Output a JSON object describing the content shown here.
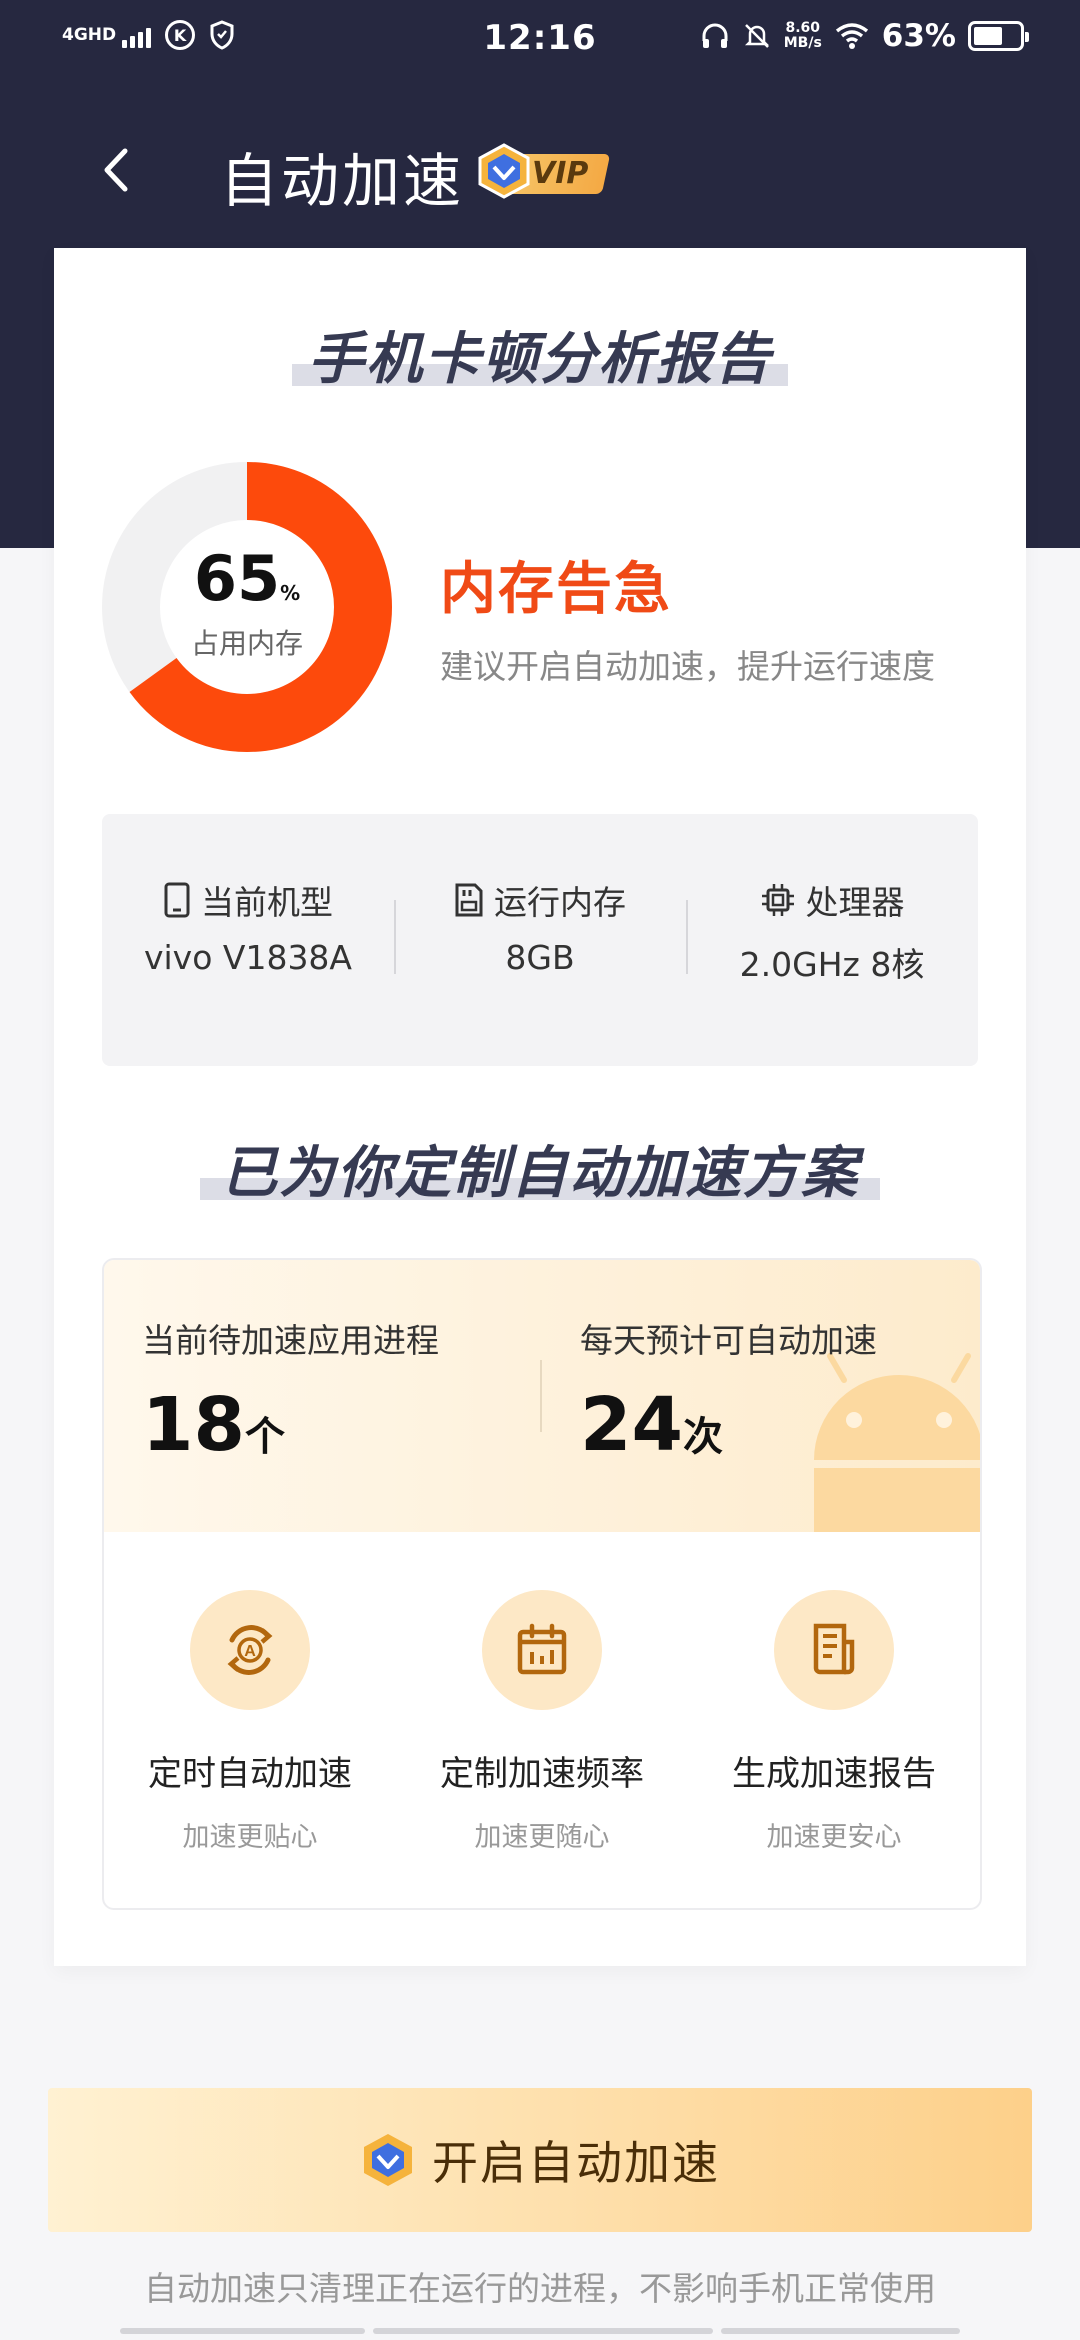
{
  "status_bar": {
    "network": "4GHD",
    "vpn_letter": "K",
    "time": "12:16",
    "speed_value": "8.60",
    "speed_unit": "MB/s",
    "battery": "63%",
    "battery_level": 0.63
  },
  "header": {
    "title": "自动加速",
    "vip_label": "VIP"
  },
  "report": {
    "section_title": "手机卡顿分析报告",
    "memory_percent": 65,
    "memory_percent_text": "65",
    "percent_sign": "%",
    "memory_label": "占用内存",
    "alert_title": "内存告急",
    "alert_desc": "建议开启自动加速，提升运行速度",
    "accent_color": "#fd4a0c"
  },
  "specs": [
    {
      "icon": "phone-icon",
      "label": "当前机型",
      "value": "vivo V1838A"
    },
    {
      "icon": "memory-card-icon",
      "label": "运行内存",
      "value": "8GB"
    },
    {
      "icon": "cpu-icon",
      "label": "处理器",
      "value": "2.0GHz 8核"
    }
  ],
  "plan": {
    "section_title": "已为你定制自动加速方案",
    "stats": [
      {
        "label": "当前待加速应用进程",
        "value": "18",
        "unit": "个"
      },
      {
        "label": "每天预计可自动加速",
        "value": "24",
        "unit": "次"
      }
    ],
    "features": [
      {
        "icon": "auto-timer-icon",
        "name": "定时自动加速",
        "sub": "加速更贴心"
      },
      {
        "icon": "calendar-icon",
        "name": "定制加速频率",
        "sub": "加速更随心"
      },
      {
        "icon": "report-icon",
        "name": "生成加速报告",
        "sub": "加速更安心"
      }
    ]
  },
  "cta": {
    "label": "开启自动加速",
    "footnote": "自动加速只清理正在运行的进程，不影响手机正常使用"
  }
}
